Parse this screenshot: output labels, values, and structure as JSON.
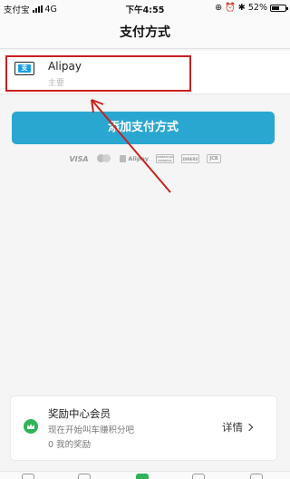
{
  "status_bar": {
    "carrier": "支付宝",
    "network": "4G",
    "time": "下午4:55",
    "battery": "52%"
  },
  "nav": {
    "title": "支付方式"
  },
  "payment_method": {
    "name": "Alipay",
    "subtitle": "主要",
    "logo_glyph": "支"
  },
  "add_button": {
    "label": "添加支付方式"
  },
  "card_brands": {
    "visa": "VISA",
    "alipay": "Alipay",
    "amex": "AMERICAN EXPRESS",
    "diners": "DINERS",
    "jcb": "JCB"
  },
  "rewards": {
    "title": "奖励中心会员",
    "description": "现在开始叫车赚积分吧",
    "count": "0 我的奖励",
    "details_label": "详情"
  },
  "colors": {
    "accent": "#2aa7d1",
    "highlight": "#c9201f",
    "reward_green": "#2fb35a"
  }
}
